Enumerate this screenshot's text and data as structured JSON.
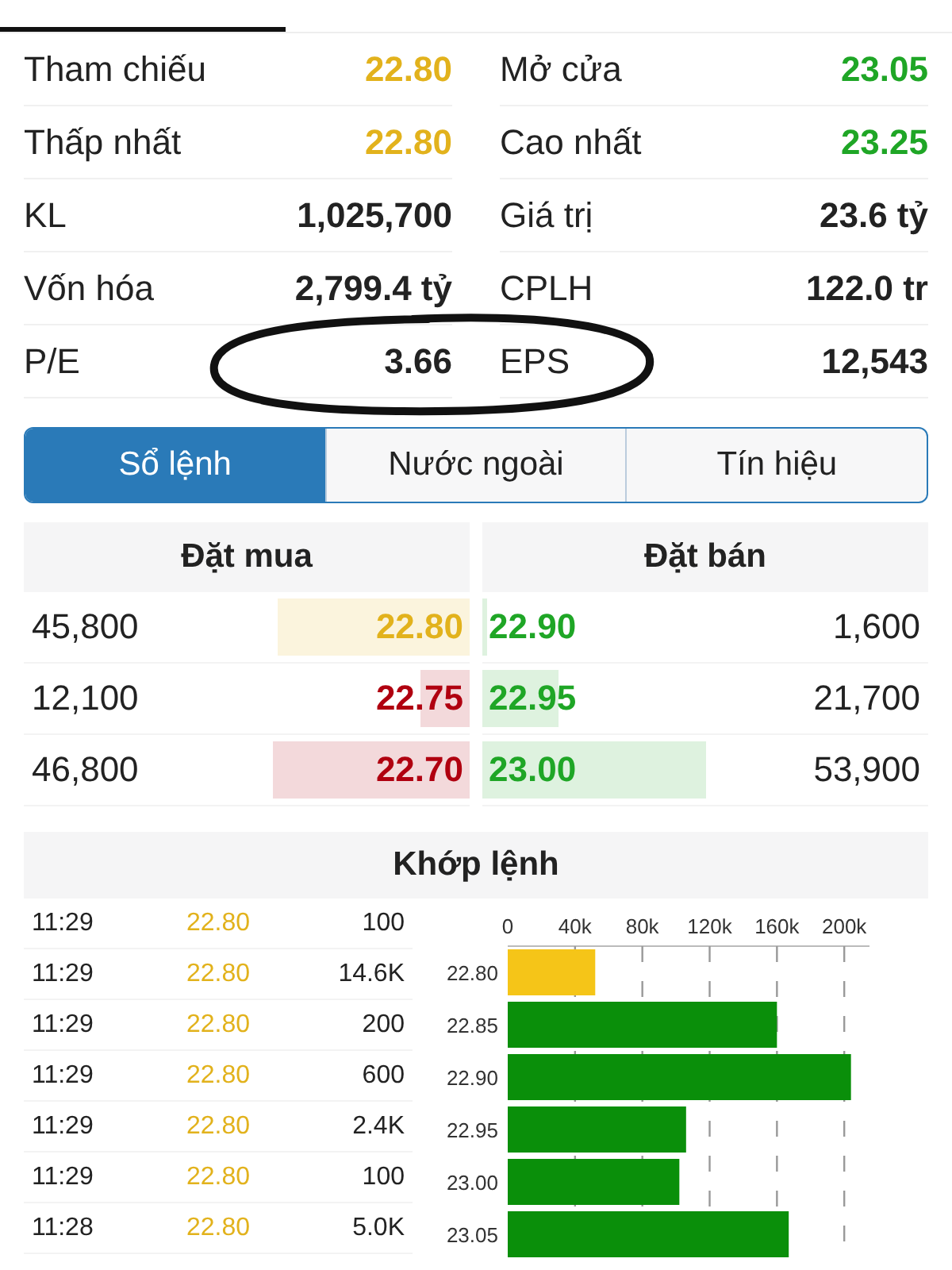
{
  "stats": [
    {
      "label": "Tham chiếu",
      "value": "22.80",
      "color": "#e2b21c"
    },
    {
      "label": "Mở cửa",
      "value": "23.05",
      "color": "#1fa626"
    },
    {
      "label": "Thấp nhất",
      "value": "22.80",
      "color": "#e2b21c"
    },
    {
      "label": "Cao nhất",
      "value": "23.25",
      "color": "#1fa626"
    },
    {
      "label": "KL",
      "value": "1,025,700",
      "color": "#222222"
    },
    {
      "label": "Giá trị",
      "value": "23.6 tỷ",
      "color": "#222222"
    },
    {
      "label": "Vốn hóa",
      "value": "2,799.4 tỷ",
      "color": "#222222"
    },
    {
      "label": "CPLH",
      "value": "122.0 tr",
      "color": "#222222"
    },
    {
      "label": "P/E",
      "value": "3.66",
      "color": "#222222"
    },
    {
      "label": "EPS",
      "value": "12,543",
      "color": "#222222"
    }
  ],
  "tabs": [
    {
      "label": "Sổ lệnh",
      "selected": true
    },
    {
      "label": "Nước ngoài",
      "selected": false
    },
    {
      "label": "Tín hiệu",
      "selected": false
    }
  ],
  "order_book": {
    "bid_title": "Đặt mua",
    "ask_title": "Đặt bán",
    "rows": [
      {
        "bid_volume": "45,800",
        "bid": {
          "price": "22.80",
          "color": "#e2b21c",
          "level": 0.43
        },
        "ask": {
          "price": "22.90",
          "color": "#1fa626",
          "level": 0.01
        },
        "ask_volume": "1,600"
      },
      {
        "bid_volume": "12,100",
        "bid": {
          "price": "22.75",
          "color": "#b00010",
          "level": 0.11
        },
        "ask": {
          "price": "22.95",
          "color": "#1fa626",
          "level": 0.17
        },
        "ask_volume": "21,700"
      },
      {
        "bid_volume": "46,800",
        "bid": {
          "price": "22.70",
          "color": "#b00010",
          "level": 0.44
        },
        "ask": {
          "price": "23.00",
          "color": "#1fa626",
          "level": 0.5
        },
        "ask_volume": "53,900"
      }
    ]
  },
  "matches": {
    "title": "Khớp lệnh",
    "rows": [
      {
        "time": "11:29",
        "price": "22.80",
        "color": "#e2b21c",
        "volume": "100"
      },
      {
        "time": "11:29",
        "price": "22.80",
        "color": "#e2b21c",
        "volume": "14.6K"
      },
      {
        "time": "11:29",
        "price": "22.80",
        "color": "#e2b21c",
        "volume": "200"
      },
      {
        "time": "11:29",
        "price": "22.80",
        "color": "#e2b21c",
        "volume": "600"
      },
      {
        "time": "11:29",
        "price": "22.80",
        "color": "#e2b21c",
        "volume": "2.4K"
      },
      {
        "time": "11:29",
        "price": "22.80",
        "color": "#e2b21c",
        "volume": "100"
      },
      {
        "time": "11:28",
        "price": "22.80",
        "color": "#e2b21c",
        "volume": "5.0K"
      }
    ],
    "chart_data": {
      "type": "bar",
      "orientation": "horizontal",
      "grid": true,
      "categories": [
        "22.80",
        "22.85",
        "22.90",
        "22.95",
        "23.00",
        "23.05"
      ],
      "series": [
        {
          "color": "#f5c518",
          "values": [
            52000,
            null,
            null,
            null,
            null,
            null
          ]
        },
        {
          "color": "#0a8f0a",
          "values": [
            null,
            160000,
            204000,
            106000,
            102000,
            167000
          ]
        }
      ],
      "xlim": [
        0,
        215000
      ],
      "xticks": [
        {
          "value": 0,
          "label": "0"
        },
        {
          "value": 40000,
          "label": "40k"
        },
        {
          "value": 80000,
          "label": "80k"
        },
        {
          "value": 120000,
          "label": "120k"
        },
        {
          "value": 160000,
          "label": "160k"
        },
        {
          "value": 200000,
          "label": "200k"
        }
      ]
    }
  }
}
